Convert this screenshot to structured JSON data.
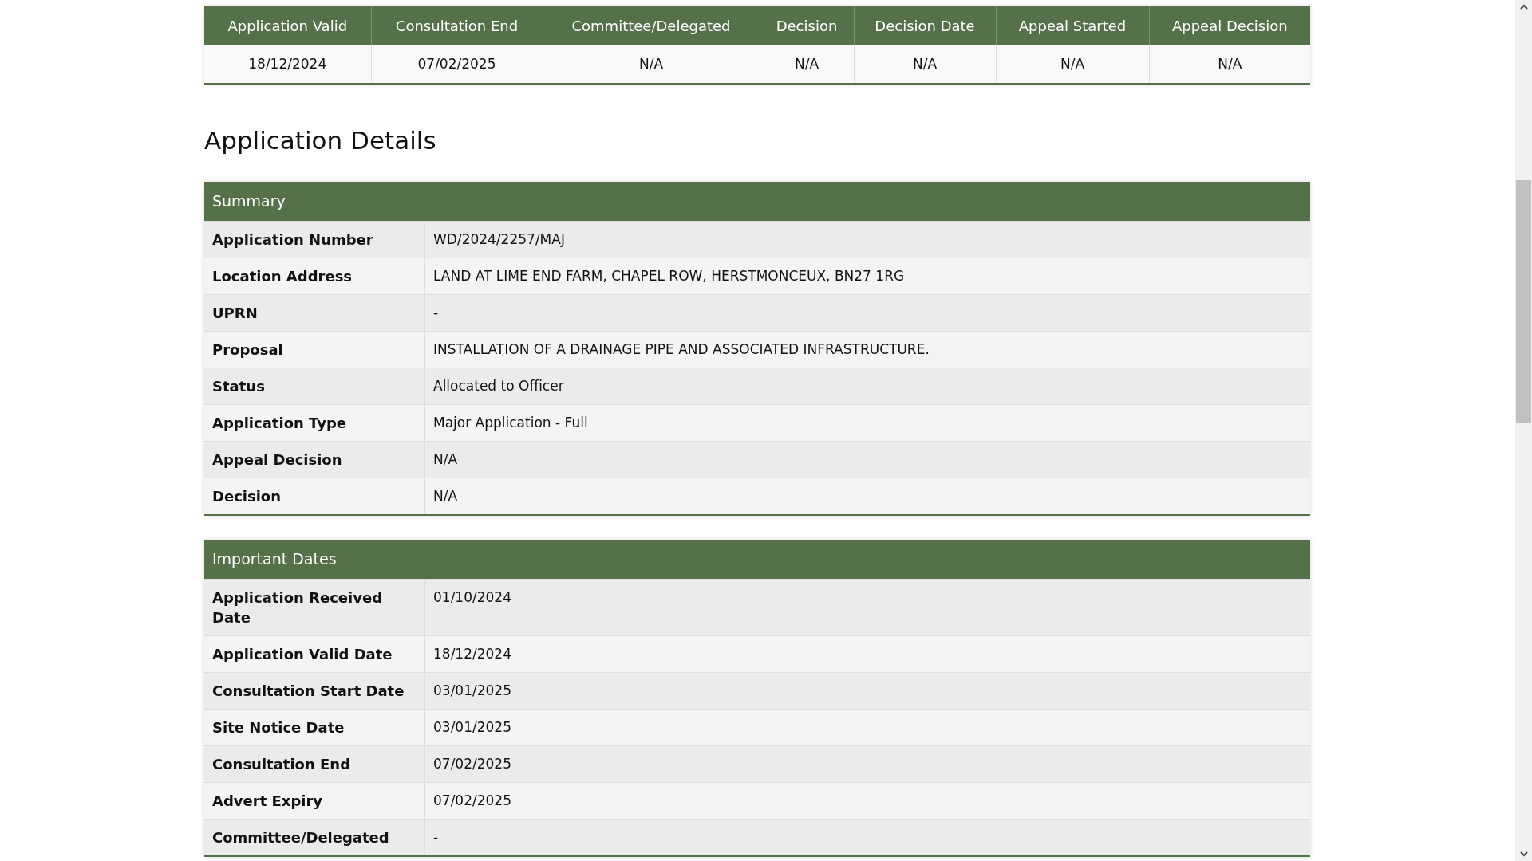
{
  "status_table": {
    "columns": [
      "Application Valid",
      "Consultation End",
      "Committee/Delegated",
      "Decision",
      "Decision Date",
      "Appeal Started",
      "Appeal Decision"
    ],
    "row": [
      "18/12/2024",
      "07/02/2025",
      "N/A",
      "N/A",
      "N/A",
      "N/A",
      "N/A"
    ]
  },
  "heading": "Application Details",
  "panels": [
    {
      "title": "Summary",
      "rows": [
        {
          "label": "Application Number",
          "value": "WD/2024/2257/MAJ"
        },
        {
          "label": "Location Address",
          "value": "LAND AT LIME END FARM, CHAPEL ROW, HERSTMONCEUX, BN27 1RG"
        },
        {
          "label": "UPRN",
          "value": "-"
        },
        {
          "label": "Proposal",
          "value": "INSTALLATION OF A DRAINAGE PIPE AND ASSOCIATED INFRASTRUCTURE."
        },
        {
          "label": "Status",
          "value": "Allocated to Officer"
        },
        {
          "label": "Application Type",
          "value": "Major Application - Full"
        },
        {
          "label": "Appeal Decision",
          "value": "N/A"
        },
        {
          "label": "Decision",
          "value": "N/A"
        }
      ]
    },
    {
      "title": "Important Dates",
      "rows": [
        {
          "label": "Application Received Date",
          "value": "01/10/2024"
        },
        {
          "label": "Application Valid Date",
          "value": "18/12/2024"
        },
        {
          "label": "Consultation Start Date",
          "value": "03/01/2025"
        },
        {
          "label": "Site Notice Date",
          "value": "03/01/2025"
        },
        {
          "label": "Consultation End",
          "value": "07/02/2025"
        },
        {
          "label": "Advert Expiry",
          "value": "07/02/2025"
        },
        {
          "label": "Committee/Delegated",
          "value": "-"
        }
      ]
    }
  ]
}
